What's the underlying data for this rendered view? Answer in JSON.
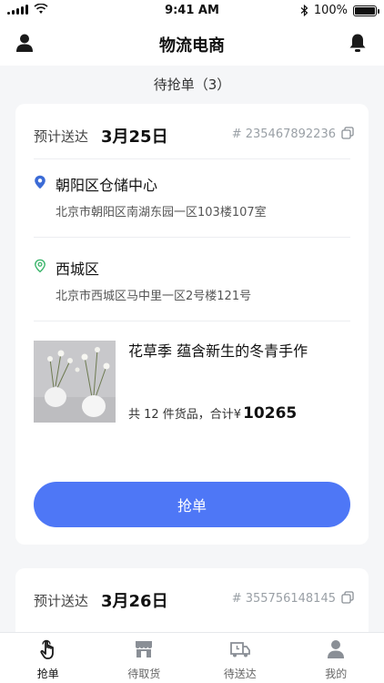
{
  "status_bar": {
    "time": "9:41 AM",
    "battery_text": "100%",
    "battery_level": 1.0
  },
  "nav": {
    "title": "物流电商"
  },
  "section": {
    "title": "待抢单（3）"
  },
  "orders": [
    {
      "eta_label": "预计送达",
      "eta_date": "3月25日",
      "order_no": "# 235467892236",
      "pickup": {
        "name": "朝阳区仓储中心",
        "address": "北京市朝阳区南湖东园一区103楼107室"
      },
      "dropoff": {
        "name": "西城区",
        "address": "北京市西城区马中里一区2号楼121号"
      },
      "product": {
        "title": "花草季 蕴含新生的冬青手作",
        "summary_prefix": "共 12 件货品，合计¥",
        "total": "10265"
      },
      "action_label": "抢单"
    },
    {
      "eta_label": "预计送达",
      "eta_date": "3月26日",
      "order_no": "# 355756148145"
    }
  ],
  "tabs": [
    {
      "label": "抢单",
      "icon": "hand-pointer-icon",
      "active": true
    },
    {
      "label": "待取货",
      "icon": "shop-icon",
      "active": false
    },
    {
      "label": "待送达",
      "icon": "truck-icon",
      "active": false
    },
    {
      "label": "我的",
      "icon": "person-icon",
      "active": false
    }
  ],
  "colors": {
    "accent": "#4e77f6",
    "pickup_pin": "#3b6bd6",
    "dropoff_pin": "#3bb56b",
    "background": "#f5f6f8"
  }
}
